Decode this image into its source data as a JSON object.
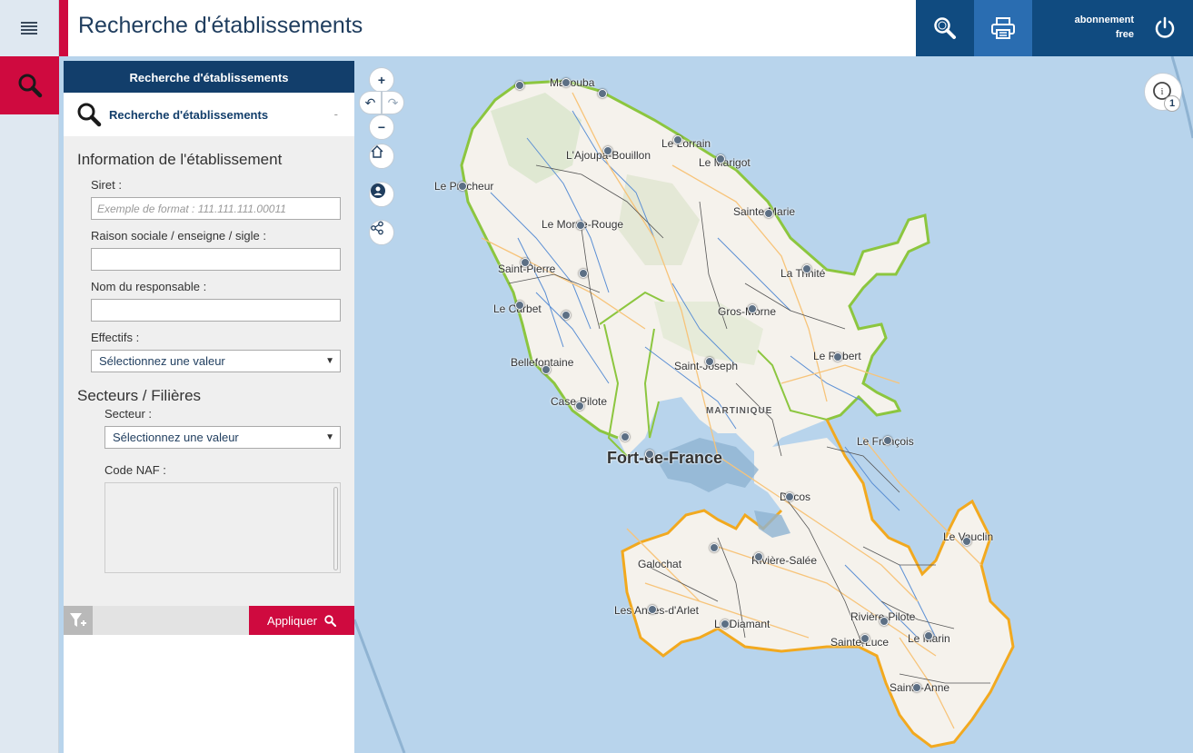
{
  "header": {
    "title": "Recherche d'établissements",
    "account_line1": "abonnement",
    "account_line2": "free",
    "icons": [
      "menu-icon",
      "search-icon",
      "print-icon",
      "power-icon"
    ]
  },
  "panel": {
    "header": "Recherche d'établissements",
    "section_label": "Recherche d'établissements",
    "collapse_symbol": "-",
    "group1_title": "Information de l'établissement",
    "siret_label": "Siret :",
    "siret_placeholder": "Exemple de format : 111.111.111.00011",
    "raison_label": "Raison sociale / enseigne / sigle :",
    "raison_value": "",
    "responsable_label": "Nom du responsable :",
    "responsable_value": "",
    "effectifs_label": "Effectifs :",
    "effectifs_value": "Sélectionnez une valeur",
    "group2_title": "Secteurs / Filières",
    "secteur_label": "Secteur :",
    "secteur_value": "Sélectionnez une valeur",
    "naf_label": "Code NAF :",
    "apply_label": "Appliquer"
  },
  "map": {
    "zoom_in": "+",
    "zoom_out": "−",
    "info_badge": "1",
    "region_label": "MARTINIQUE",
    "places": [
      {
        "name": "Macouba"
      },
      {
        "name": "L'Ajoupa-Bouillon"
      },
      {
        "name": "Le Lorrain"
      },
      {
        "name": "Le Marigot"
      },
      {
        "name": "Le Prêcheur"
      },
      {
        "name": "Sainte-Marie"
      },
      {
        "name": "Le Morne-Rouge"
      },
      {
        "name": "Saint-Pierre"
      },
      {
        "name": "La Trinité"
      },
      {
        "name": "Le Carbet"
      },
      {
        "name": "Gros-Morne"
      },
      {
        "name": "Le Robert"
      },
      {
        "name": "Bellefontaine"
      },
      {
        "name": "Saint-Joseph"
      },
      {
        "name": "Case-Pilote"
      },
      {
        "name": "Le François"
      },
      {
        "name": "Fort-de-France"
      },
      {
        "name": "Ducos"
      },
      {
        "name": "Le Vauclin"
      },
      {
        "name": "Galochat"
      },
      {
        "name": "Rivière-Salée"
      },
      {
        "name": "Les Anses-d'Arlet"
      },
      {
        "name": "Rivière-Pilote"
      },
      {
        "name": "Le Diamant"
      },
      {
        "name": "Sainte-Luce"
      },
      {
        "name": "Le Marin"
      },
      {
        "name": "Sainte-Anne"
      }
    ]
  },
  "colors": {
    "navy": "#123e6b",
    "accent_red": "#cf0a3f",
    "sea": "#b8d4ec",
    "land": "#f5f2ec",
    "north_border": "#8cc63f",
    "south_border": "#f2a91f"
  }
}
